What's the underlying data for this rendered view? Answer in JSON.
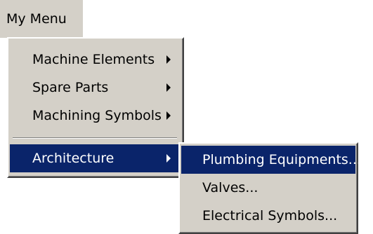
{
  "menubar": {
    "title": "My Menu"
  },
  "main_menu": {
    "items": [
      {
        "label": "Machine Elements",
        "has_submenu": true,
        "highlighted": false
      },
      {
        "label": "Spare Parts",
        "has_submenu": true,
        "highlighted": false
      },
      {
        "label": "Machining Symbols",
        "has_submenu": true,
        "highlighted": false
      },
      {
        "label": "Architecture",
        "has_submenu": true,
        "highlighted": true
      }
    ],
    "arrow_icon": "chevron-right-icon"
  },
  "sub_menu": {
    "items": [
      {
        "label": "Plumbing Equipments...",
        "highlighted": true
      },
      {
        "label": "Valves...",
        "highlighted": false
      },
      {
        "label": "Electrical Symbols...",
        "highlighted": false
      }
    ]
  },
  "colors": {
    "menu_background": "#d4d0c8",
    "highlight": "#0a246a",
    "highlight_text": "#ffffff"
  }
}
